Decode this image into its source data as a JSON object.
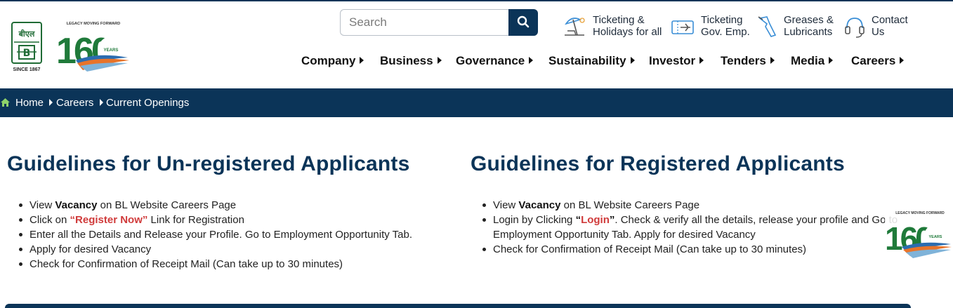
{
  "header": {
    "logo_bl": {
      "line1": "बीएल",
      "since": "SINCE 1867"
    },
    "logo_160": {
      "tagline": "LEGACY MOVING FORWARD",
      "number": "160",
      "years": "YEARS"
    },
    "search": {
      "placeholder": "Search"
    },
    "quick_links": [
      {
        "line1": "Ticketing &",
        "line2": "Holidays for all",
        "icon": "beach-umbrella-icon"
      },
      {
        "line1": "Ticketing",
        "line2": "Gov. Emp.",
        "icon": "airplane-ticket-icon"
      },
      {
        "line1": "Greases &",
        "line2": "Lubricants",
        "icon": "grease-gun-icon"
      },
      {
        "line1": "Contact",
        "line2": "Us",
        "icon": "headset-icon"
      }
    ],
    "nav": [
      "Company",
      "Business",
      "Governance",
      "Sustainability",
      "Investor",
      "Tenders",
      "Media",
      "Careers"
    ]
  },
  "breadcrumb": {
    "items": [
      "Home",
      "Careers",
      "Current Openings"
    ]
  },
  "unregistered": {
    "title": "Guidelines for Un-registered Applicants",
    "items": [
      {
        "pre": "View ",
        "bold": "Vacancy",
        "post": " on BL Website Careers Page"
      },
      {
        "pre": "Click on ",
        "red": "“Register Now”",
        "post": " Link for Registration"
      },
      {
        "text": "Enter all the Details and Release your Profile. Go to Employment Opportunity Tab."
      },
      {
        "text": "Apply for desired Vacancy"
      },
      {
        "text": "Check for Confirmation of Receipt Mail (Can take up to 30 minutes)"
      }
    ]
  },
  "registered": {
    "title": "Guidelines for Registered Applicants",
    "items": [
      {
        "pre": "View ",
        "bold": "Vacancy",
        "post": " on BL Website Careers Page"
      },
      {
        "pre": "Login by Clicking ",
        "red_q1": "“",
        "red": "Login",
        "red_q2": "”",
        "post": ". Check & verify all the details, release your profile and Go to",
        "line2": "Employment Opportunity Tab. Apply for desired Vacancy"
      },
      {
        "text": "Check for Confirmation of Receipt Mail (Can take up to 30 minutes)"
      }
    ]
  },
  "colors": {
    "navy": "#0b3458",
    "red": "#d03b3b",
    "green": "#1f7a3a"
  }
}
